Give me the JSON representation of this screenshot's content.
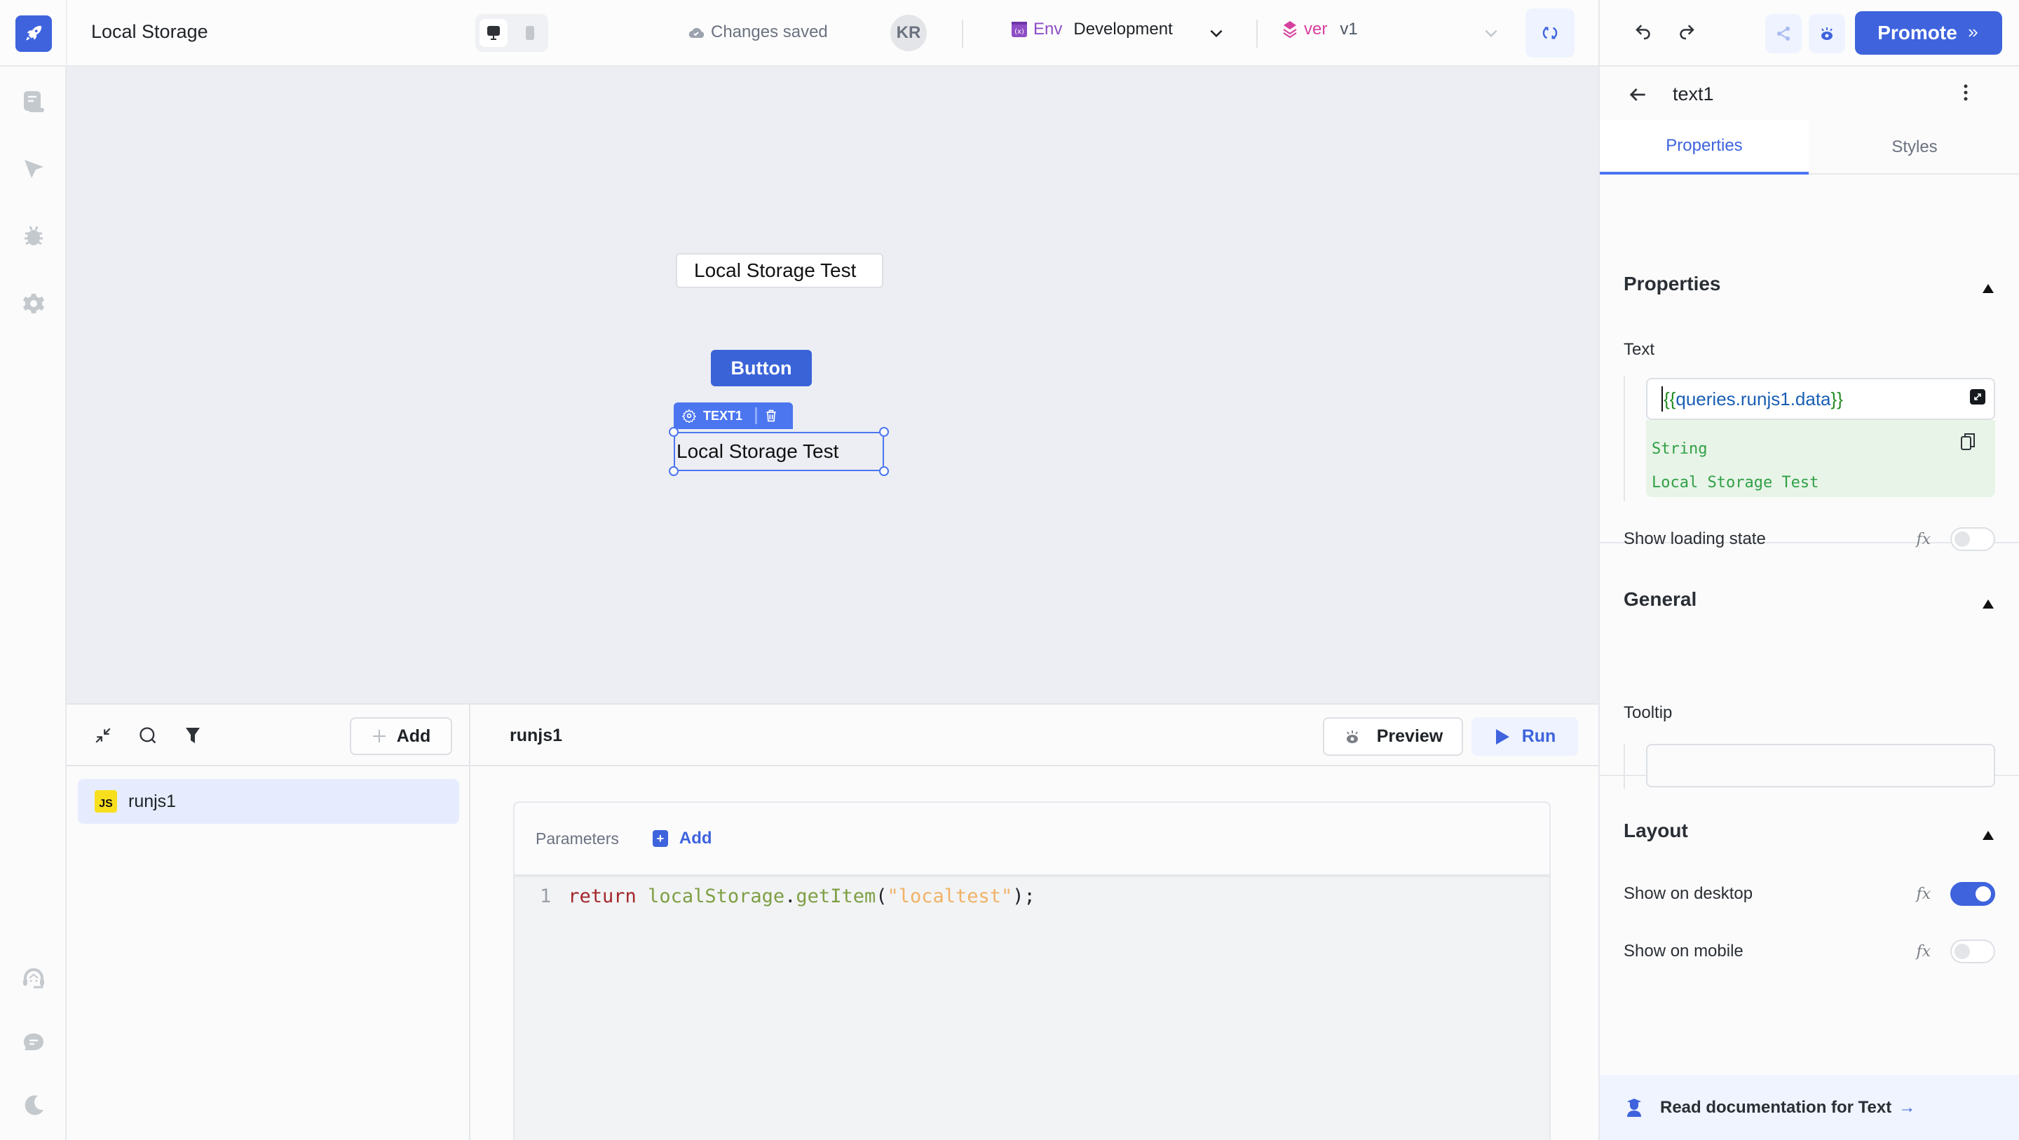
{
  "app": {
    "title": "Local Storage",
    "status": "Changes saved",
    "user_initials": "KR"
  },
  "topbar": {
    "device_options": [
      "desktop",
      "mobile"
    ],
    "device_selected": "desktop",
    "env_label": "Env",
    "env_value": "Development",
    "version_label": "ver",
    "version_value": "v1",
    "promote_label": "Promote",
    "colors": {
      "accent": "#3e63dd",
      "env": "#8e4ec6",
      "version": "#d6409f"
    }
  },
  "sidebar": {
    "top_items": [
      {
        "name": "pages",
        "icon": "file-text-icon"
      },
      {
        "name": "inspector",
        "icon": "cursor-pointer-icon"
      },
      {
        "name": "debugger",
        "icon": "bug-icon"
      },
      {
        "name": "settings",
        "icon": "gear-icon"
      }
    ],
    "bottom_items": [
      {
        "name": "support",
        "icon": "headset-icon"
      },
      {
        "name": "comments",
        "icon": "chat-icon"
      },
      {
        "name": "theme",
        "icon": "moon-icon"
      }
    ]
  },
  "canvas": {
    "widgets": {
      "text_box": "Local Storage Test",
      "button": "Button",
      "selected_text": "Local Storage Test"
    },
    "selected_tag": "TEXT1"
  },
  "queries": {
    "add_label": "Add",
    "items": [
      {
        "badge": "JS",
        "name": "runjs1",
        "selected": true
      }
    ]
  },
  "editor": {
    "query_name": "runjs1",
    "preview_label": "Preview",
    "run_label": "Run",
    "parameters_label": "Parameters",
    "parameters_add_label": "Add",
    "code": {
      "line_number": "1",
      "keyword": "return",
      "object": "localStorage",
      "dot": ".",
      "method": "getItem",
      "open_paren": "(",
      "string": "\"localtest\"",
      "close": ");"
    }
  },
  "inspector": {
    "component_name": "text1",
    "tabs": [
      {
        "label": "Properties",
        "active": true
      },
      {
        "label": "Styles",
        "active": false
      }
    ],
    "sections": {
      "properties": {
        "title": "Properties",
        "text_label": "Text",
        "text_value_open": "{{",
        "text_value_expr": "queries.runjs1.data",
        "text_value_close": "}}",
        "preview_type": "String",
        "preview_value": "Local Storage Test",
        "loading_label": "Show loading state",
        "loading_on": false
      },
      "general": {
        "title": "General",
        "tooltip_label": "Tooltip",
        "tooltip_value": ""
      },
      "layout": {
        "title": "Layout",
        "desktop_label": "Show on desktop",
        "desktop_on": true,
        "mobile_label": "Show on mobile",
        "mobile_on": false
      }
    },
    "fx_label": "fx",
    "doc_link": "Read documentation for Text"
  }
}
